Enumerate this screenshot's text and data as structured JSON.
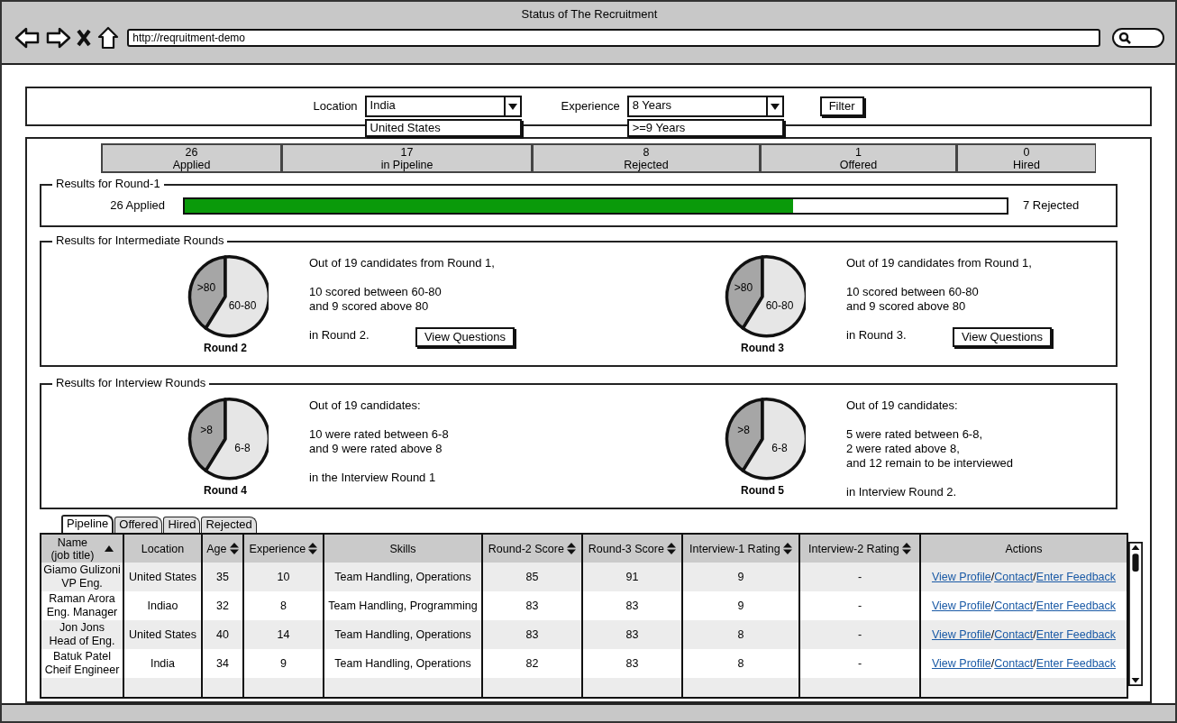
{
  "window": {
    "title": "Status of The Recruitment",
    "url": "http://reqruitment-demo"
  },
  "filters": [
    {
      "label": "Location",
      "value": "India",
      "options": [
        "United States"
      ]
    },
    {
      "label": "Experience",
      "value": "8 Years",
      "options": [
        ">=9 Years"
      ]
    }
  ],
  "filter_button": "Filter",
  "summary": [
    {
      "value": "26",
      "label": "Applied"
    },
    {
      "value": "17",
      "label": "in Pipeline"
    },
    {
      "value": "8",
      "label": "Rejected"
    },
    {
      "value": "1",
      "label": "Offered"
    },
    {
      "value": "0",
      "label": "Hired"
    }
  ],
  "round1": {
    "title": "Results for Round-1",
    "applied": "26 Applied",
    "level": 0.74,
    "rejected": "7 Rejected"
  },
  "sections": [
    {
      "title": "Results for Intermediate Rounds",
      "panels": [
        {
          "caption": "Round 2",
          "slices": [
            {
              "label": ">80",
              "color": "#a6a6a6"
            },
            {
              "label": "60-80",
              "color": "#e6e6e6"
            }
          ],
          "paragraphs": [
            "Out of 19 candidates from Round 1,",
            "10 scored between 60-80\nand 9 scored above 80",
            "in Round 2."
          ],
          "button": "View Questions"
        },
        {
          "caption": "Round 3",
          "slices": [
            {
              "label": ">80",
              "color": "#a6a6a6"
            },
            {
              "label": "60-80",
              "color": "#e6e6e6"
            }
          ],
          "paragraphs": [
            "Out of 19 candidates from Round 1,",
            "10 scored between 60-80\nand 9 scored above 80",
            "in Round 3."
          ],
          "button": "View Questions"
        }
      ]
    },
    {
      "title": "Results for Interview Rounds",
      "panels": [
        {
          "caption": "Round 4",
          "slices": [
            {
              "label": ">8",
              "color": "#a6a6a6"
            },
            {
              "label": "6-8",
              "color": "#e6e6e6"
            }
          ],
          "paragraphs": [
            "Out of 19 candidates:",
            "10 were rated between 6-8\nand 9 were rated above 8",
            "in the Interview Round 1"
          ]
        },
        {
          "caption": "Round 5",
          "slices": [
            {
              "label": ">8",
              "color": "#a6a6a6"
            },
            {
              "label": "6-8",
              "color": "#e6e6e6"
            }
          ],
          "paragraphs": [
            "Out of 19 candidates:",
            "5 were rated between 6-8,\n2 were rated above 8,\nand 12 remain to be interviewed",
            "in Interview Round 2."
          ]
        }
      ]
    }
  ],
  "tabs": [
    {
      "label": "Pipeline",
      "selected": true
    },
    {
      "label": "Offered",
      "selected": false
    },
    {
      "label": "Hired",
      "selected": false
    },
    {
      "label": "Rejected",
      "selected": false
    }
  ],
  "table": {
    "columns": [
      {
        "label": "Name\n(job title)",
        "sortable": true,
        "sorted": true
      },
      {
        "label": "Location",
        "sortable": false
      },
      {
        "label": "Age",
        "sortable": true,
        "sorted": false
      },
      {
        "label": "Experience",
        "sortable": true,
        "sorted": false
      },
      {
        "label": "Skills",
        "sortable": false
      },
      {
        "label": "Round-2 Score",
        "sortable": true,
        "sorted": false
      },
      {
        "label": "Round-3 Score",
        "sortable": true,
        "sorted": false
      },
      {
        "label": "Interview-1 Rating",
        "sortable": true,
        "sorted": false
      },
      {
        "label": "Interview-2 Rating",
        "sortable": true,
        "sorted": false
      },
      {
        "label": "Actions",
        "sortable": false
      }
    ],
    "rows": [
      {
        "cells": [
          "Giamo Gulizoni\nVP Eng.",
          "United States",
          "35",
          "10",
          "Team Handling, Operations",
          "85",
          "91",
          "9",
          "-"
        ],
        "actions": [
          {
            "kind": "link",
            "text": "View Profile"
          },
          {
            "kind": "separator",
            "text": "/"
          },
          {
            "kind": "link",
            "text": "Contact"
          },
          {
            "kind": "separator",
            "text": "/"
          },
          {
            "kind": "link",
            "text": "Enter Feedback"
          }
        ]
      },
      {
        "cells": [
          "Raman Arora\nEng. Manager",
          "Indiao",
          "32",
          "8",
          "Team Handling, Programming",
          "83",
          "83",
          "9",
          "-"
        ],
        "actions": [
          {
            "kind": "link",
            "text": "View Profile"
          },
          {
            "kind": "separator",
            "text": "/"
          },
          {
            "kind": "link",
            "text": "Contact"
          },
          {
            "kind": "separator",
            "text": "/"
          },
          {
            "kind": "link",
            "text": "Enter Feedback"
          }
        ]
      },
      {
        "cells": [
          "Jon Jons\nHead of Eng.",
          "United States",
          "40",
          "14",
          "Team Handling, Operations",
          "83",
          "83",
          "8",
          "-"
        ],
        "actions": [
          {
            "kind": "link",
            "text": "View Profile"
          },
          {
            "kind": "separator",
            "text": "/"
          },
          {
            "kind": "link",
            "text": "Contact"
          },
          {
            "kind": "separator",
            "text": "/"
          },
          {
            "kind": "link",
            "text": "Enter Feedback"
          }
        ]
      },
      {
        "cells": [
          "Batuk Patel\nCheif Engineer",
          "India",
          "34",
          "9",
          "Team Handling, Operations",
          "82",
          "83",
          "8",
          "-"
        ],
        "actions": [
          {
            "kind": "link",
            "text": "View Profile"
          },
          {
            "kind": "separator",
            "text": "/"
          },
          {
            "kind": "link",
            "text": "Contact"
          },
          {
            "kind": "separator",
            "text": "/"
          },
          {
            "kind": "link",
            "text": "Enter Feedback"
          }
        ]
      }
    ]
  }
}
